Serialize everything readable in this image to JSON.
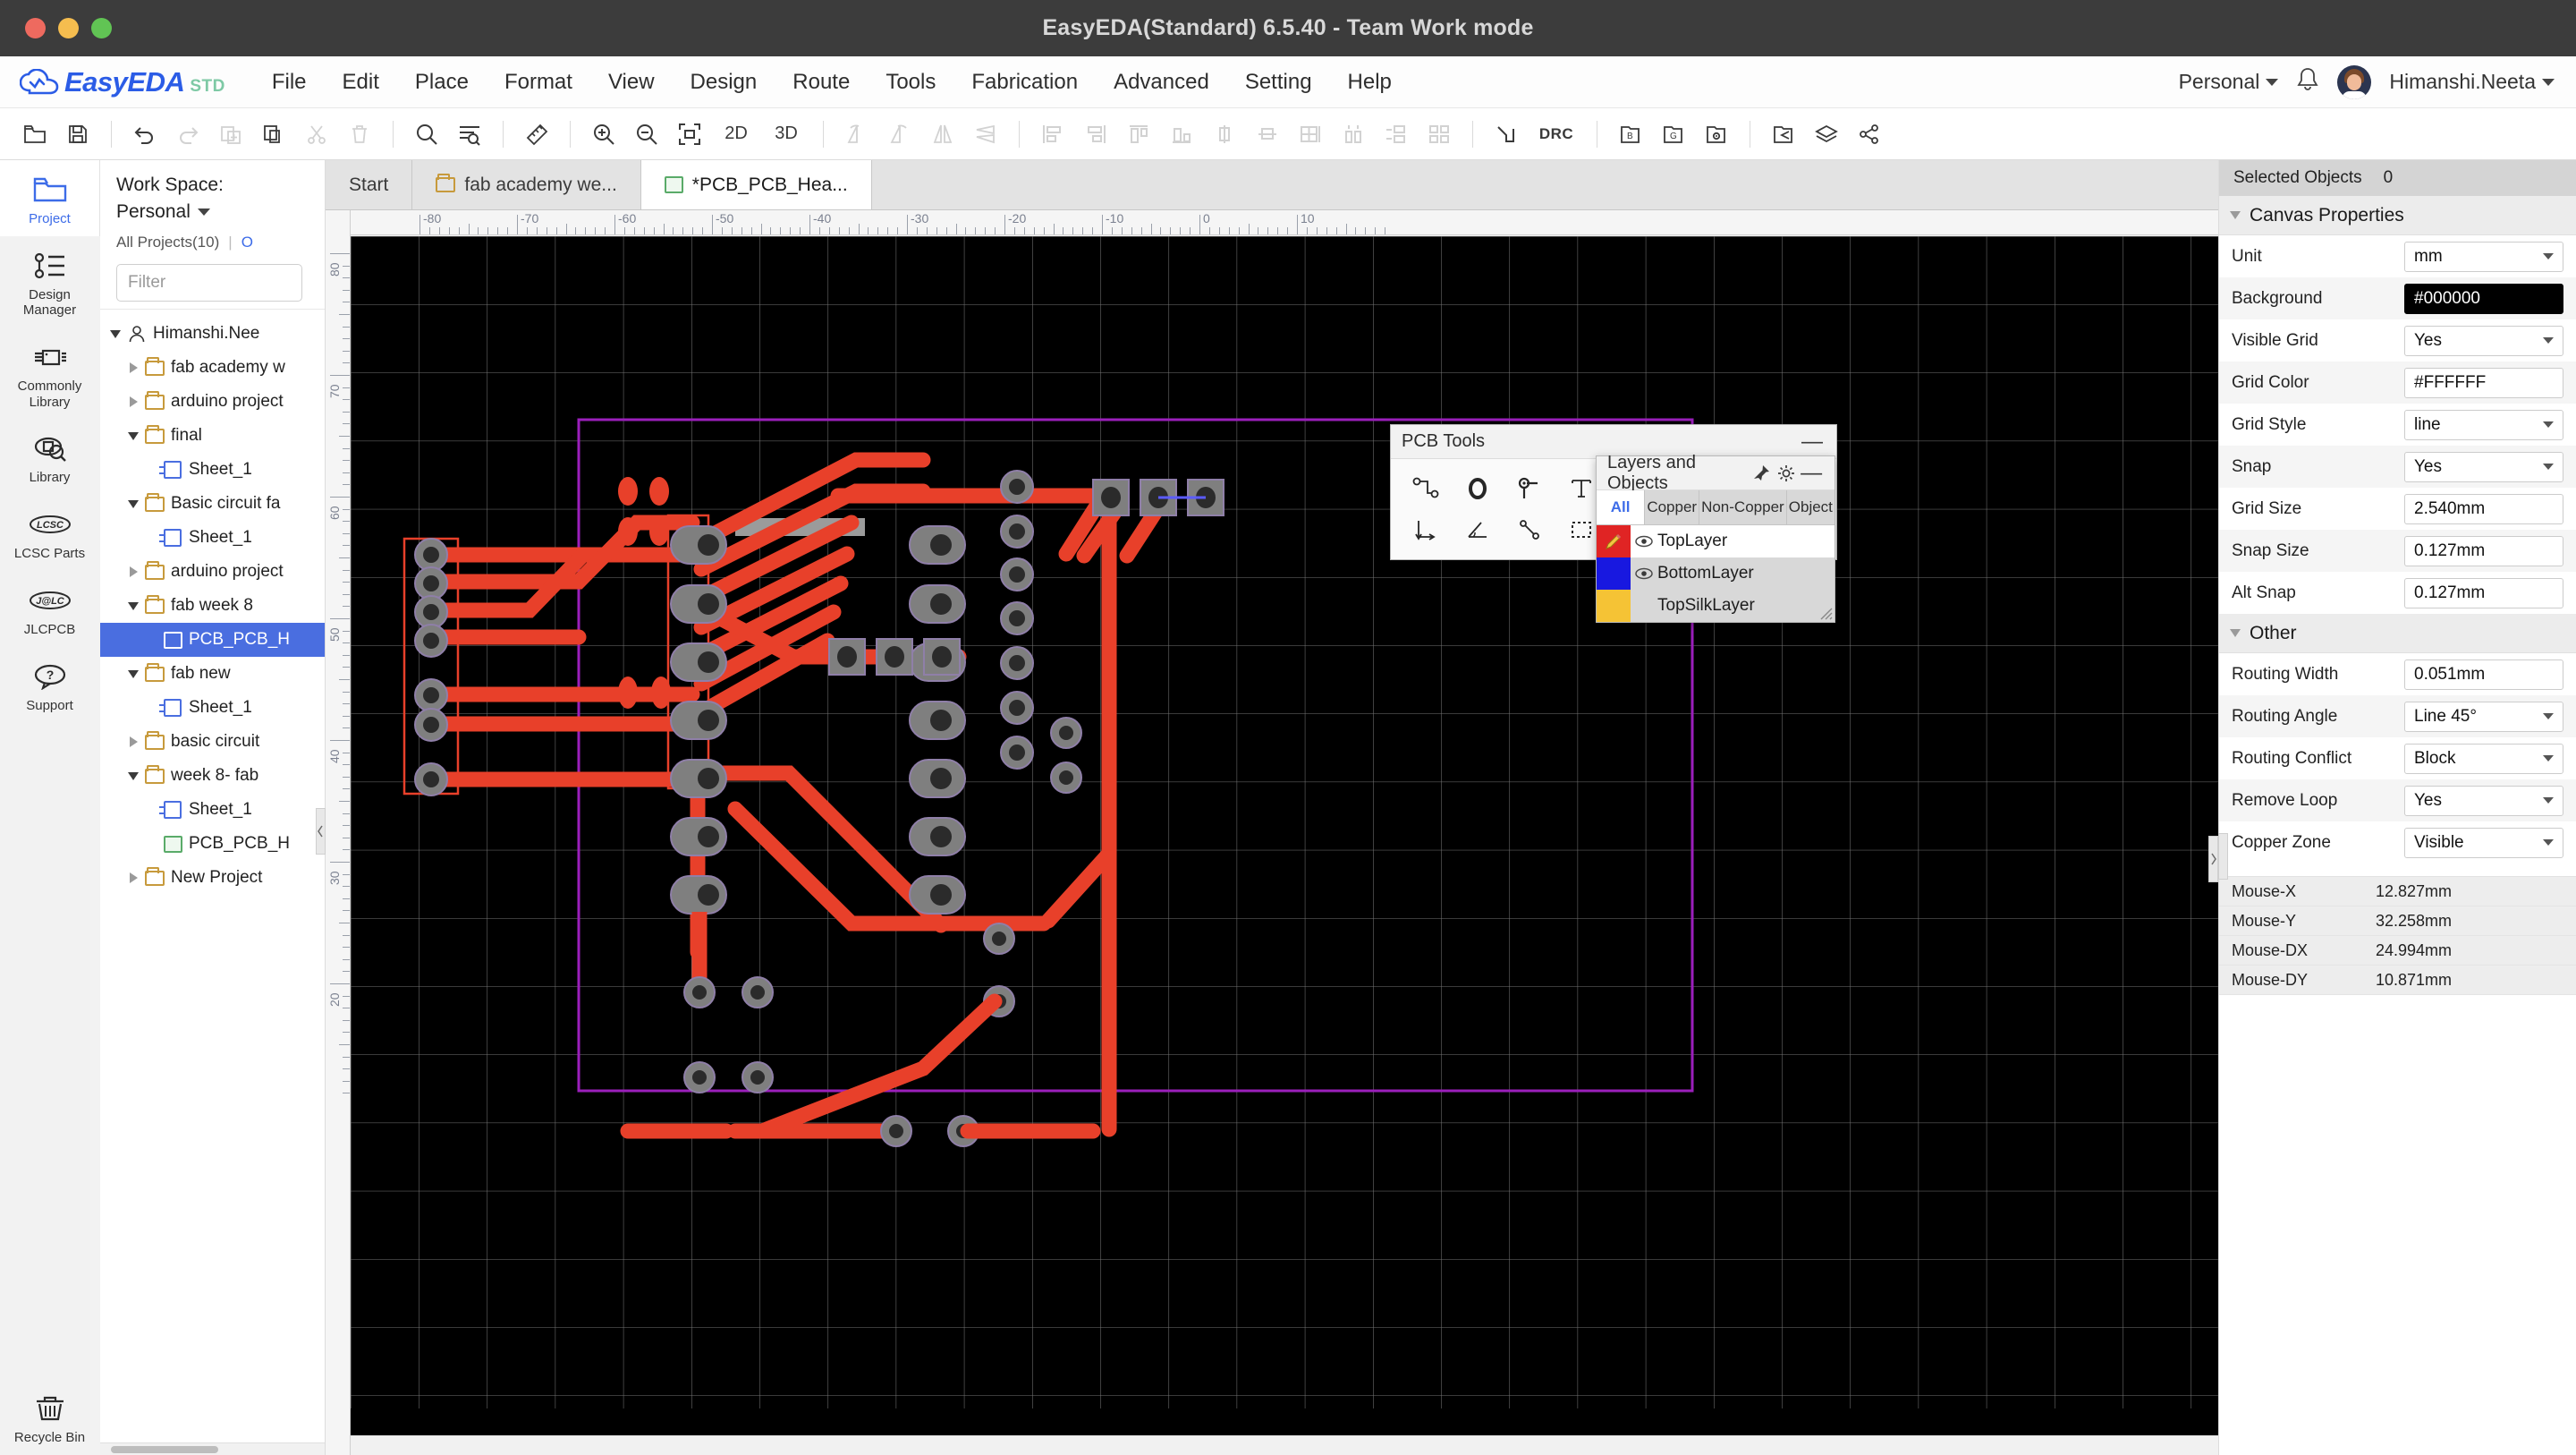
{
  "window": {
    "title": "EasyEDA(Standard) 6.5.40 - Team Work mode"
  },
  "brand": {
    "name": "EasyEDA",
    "suffix": "STD"
  },
  "menu": {
    "items": [
      "File",
      "Edit",
      "Place",
      "Format",
      "View",
      "Design",
      "Route",
      "Tools",
      "Fabrication",
      "Advanced",
      "Setting",
      "Help"
    ],
    "workspace_label": "Personal",
    "account_name": "Himanshi.Neeta"
  },
  "toolbar": {
    "items": [
      {
        "name": "open-folder-icon",
        "label": "",
        "disabled": false
      },
      {
        "name": "save-icon",
        "label": "",
        "disabled": false
      },
      {
        "name": "undo-icon",
        "label": "",
        "disabled": false
      },
      {
        "name": "redo-icon",
        "label": "",
        "disabled": true
      },
      {
        "name": "paste-icon",
        "label": "",
        "disabled": true
      },
      {
        "name": "copy-icon",
        "label": "",
        "disabled": false
      },
      {
        "name": "cut-icon",
        "label": "",
        "disabled": true
      },
      {
        "name": "delete-icon",
        "label": "",
        "disabled": true
      },
      {
        "name": "search-icon",
        "label": "",
        "disabled": false
      },
      {
        "name": "find-similar-icon",
        "label": "",
        "disabled": false
      },
      {
        "name": "ruler-icon",
        "label": "",
        "disabled": false
      },
      {
        "name": "zoom-in-icon",
        "label": "",
        "disabled": false
      },
      {
        "name": "zoom-out-icon",
        "label": "",
        "disabled": false
      },
      {
        "name": "fit-to-screen-icon",
        "label": "",
        "disabled": false
      },
      {
        "name": "view-2d-button",
        "label": "2D",
        "disabled": false
      },
      {
        "name": "view-3d-button",
        "label": "3D",
        "disabled": false
      },
      {
        "name": "rotate-ccw-icon",
        "label": "",
        "disabled": true
      },
      {
        "name": "rotate-cw-icon",
        "label": "",
        "disabled": true
      },
      {
        "name": "mirror-vertical-icon",
        "label": "",
        "disabled": true
      },
      {
        "name": "mirror-horizontal-icon",
        "label": "",
        "disabled": true
      },
      {
        "name": "align-left-icon",
        "label": "",
        "disabled": true
      },
      {
        "name": "align-right-icon",
        "label": "",
        "disabled": true
      },
      {
        "name": "align-top-icon",
        "label": "",
        "disabled": true
      },
      {
        "name": "align-bottom-icon",
        "label": "",
        "disabled": true
      },
      {
        "name": "align-center-vertical-icon",
        "label": "",
        "disabled": true
      },
      {
        "name": "align-center-horizontal-icon",
        "label": "",
        "disabled": true
      },
      {
        "name": "grid-align-icon",
        "label": "",
        "disabled": true
      },
      {
        "name": "distribute-vertical-icon",
        "label": "",
        "disabled": true
      },
      {
        "name": "distribute-horizontal-icon",
        "label": "",
        "disabled": true
      },
      {
        "name": "arrange-icon",
        "label": "",
        "disabled": true
      },
      {
        "name": "autoroute-icon",
        "label": "",
        "disabled": false
      },
      {
        "name": "drc-button",
        "label": "DRC",
        "disabled": false
      },
      {
        "name": "board-outline-icon",
        "label": "B",
        "disabled": false
      },
      {
        "name": "gerber-icon",
        "label": "G",
        "disabled": false
      },
      {
        "name": "drill-icon",
        "label": "",
        "disabled": false
      },
      {
        "name": "import-icon",
        "label": "",
        "disabled": false
      },
      {
        "name": "layers-icon",
        "label": "",
        "disabled": false
      },
      {
        "name": "share-icon",
        "label": "",
        "disabled": false
      }
    ]
  },
  "rail": {
    "items": [
      {
        "name": "project",
        "label": "Project",
        "active": true
      },
      {
        "name": "design-manager",
        "label": "Design Manager",
        "active": false
      },
      {
        "name": "commonly-library",
        "label": "Commonly Library",
        "active": false
      },
      {
        "name": "library",
        "label": "Library",
        "active": false
      },
      {
        "name": "lcsc-parts",
        "label": "LCSC Parts",
        "active": false
      },
      {
        "name": "jlcpcb",
        "label": "JLCPCB",
        "active": false
      },
      {
        "name": "support",
        "label": "Support",
        "active": false
      }
    ],
    "bottom": {
      "name": "recycle-bin",
      "label": "Recycle Bin"
    }
  },
  "project_panel": {
    "workspace_title": "Work Space:",
    "workspace_value": "Personal",
    "all_projects": "All Projects(10)",
    "divider": "|",
    "second_link": "O",
    "filter_placeholder": "Filter",
    "tree": [
      {
        "label": "Himanshi.Nee",
        "indent": 0,
        "twisty": "down",
        "icon": "user",
        "selected": false
      },
      {
        "label": "fab academy w",
        "indent": 1,
        "twisty": "right",
        "icon": "folder",
        "selected": false
      },
      {
        "label": "arduino project",
        "indent": 1,
        "twisty": "right",
        "icon": "folder",
        "selected": false
      },
      {
        "label": "final",
        "indent": 1,
        "twisty": "down",
        "icon": "folder",
        "selected": false
      },
      {
        "label": "Sheet_1",
        "indent": 2,
        "twisty": "none",
        "icon": "sheet",
        "selected": false
      },
      {
        "label": "Basic circuit fa",
        "indent": 1,
        "twisty": "down",
        "icon": "folder",
        "selected": false
      },
      {
        "label": "Sheet_1",
        "indent": 2,
        "twisty": "none",
        "icon": "sheet",
        "selected": false
      },
      {
        "label": "arduino project",
        "indent": 1,
        "twisty": "right",
        "icon": "folder",
        "selected": false
      },
      {
        "label": "fab week 8",
        "indent": 1,
        "twisty": "down",
        "icon": "folder",
        "selected": false
      },
      {
        "label": "PCB_PCB_H",
        "indent": 2,
        "twisty": "none",
        "icon": "pcb",
        "selected": true
      },
      {
        "label": "fab new",
        "indent": 1,
        "twisty": "down",
        "icon": "folder",
        "selected": false
      },
      {
        "label": "Sheet_1",
        "indent": 2,
        "twisty": "none",
        "icon": "sheet",
        "selected": false
      },
      {
        "label": "basic circuit",
        "indent": 1,
        "twisty": "right",
        "icon": "folder",
        "selected": false
      },
      {
        "label": "week 8- fab",
        "indent": 1,
        "twisty": "down",
        "icon": "folder",
        "selected": false
      },
      {
        "label": "Sheet_1",
        "indent": 2,
        "twisty": "none",
        "icon": "sheet",
        "selected": false
      },
      {
        "label": "PCB_PCB_H",
        "indent": 2,
        "twisty": "none",
        "icon": "pcb",
        "selected": false
      },
      {
        "label": "New Project",
        "indent": 1,
        "twisty": "right",
        "icon": "folder",
        "selected": false
      }
    ]
  },
  "tabs": [
    {
      "label": "Start",
      "icon": "none",
      "active": false
    },
    {
      "label": "fab academy we...",
      "icon": "folder",
      "active": false
    },
    {
      "label": "*PCB_PCB_Hea...",
      "icon": "pcb",
      "active": true
    }
  ],
  "rulers": {
    "horizontal_labels": [
      "-80",
      "-70",
      "-60",
      "-50",
      "-40",
      "-30",
      "-20",
      "-10",
      "0",
      "10"
    ],
    "vertical_labels": [
      "80",
      "70",
      "60",
      "50",
      "40",
      "30",
      "20"
    ]
  },
  "pcb_tools": {
    "title": "PCB Tools",
    "minimize": "—",
    "tools": [
      "track-icon",
      "via-icon",
      "pad-icon",
      "text-icon",
      "arc-icon",
      "arc-reverse-icon",
      "circle-icon",
      "rect-icon",
      "dimension-icon",
      "angle-icon",
      "polyline-icon",
      "solid-region-icon",
      "copper-area-icon",
      "measure-icon",
      "image-icon",
      "hole-icon"
    ]
  },
  "layers_panel": {
    "title": "Layers and Objects",
    "pin_icon": "pin-icon",
    "settings_icon": "gear-icon",
    "minimize_icon": "minimize-icon",
    "tabs": [
      "All",
      "Copper",
      "Non-Copper",
      "Object"
    ],
    "active_tab": "All",
    "layers": [
      {
        "name": "TopLayer",
        "color": "#e02424",
        "visible": true,
        "active": true,
        "editing": true
      },
      {
        "name": "BottomLayer",
        "color": "#1818e0",
        "visible": true,
        "active": false,
        "editing": false
      },
      {
        "name": "TopSilkLayer",
        "color": "#f5c335",
        "visible": false,
        "active": false,
        "editing": false
      }
    ]
  },
  "properties": {
    "selected_objects_label": "Selected Objects",
    "selected_objects_count": "0",
    "canvas_section": "Canvas Properties",
    "other_section": "Other",
    "rows": [
      {
        "label": "Unit",
        "value": "mm",
        "type": "select"
      },
      {
        "label": "Background",
        "value": "#000000",
        "type": "color-black"
      },
      {
        "label": "Visible Grid",
        "value": "Yes",
        "type": "select"
      },
      {
        "label": "Grid Color",
        "value": "#FFFFFF",
        "type": "text"
      },
      {
        "label": "Grid Style",
        "value": "line",
        "type": "select"
      },
      {
        "label": "Snap",
        "value": "Yes",
        "type": "select"
      },
      {
        "label": "Grid Size",
        "value": "2.540mm",
        "type": "text"
      },
      {
        "label": "Snap Size",
        "value": "0.127mm",
        "type": "text"
      },
      {
        "label": "Alt Snap",
        "value": "0.127mm",
        "type": "text"
      }
    ],
    "other_rows": [
      {
        "label": "Routing Width",
        "value": "0.051mm",
        "type": "text"
      },
      {
        "label": "Routing Angle",
        "value": "Line 45°",
        "type": "select"
      },
      {
        "label": "Routing Conflict",
        "value": "Block",
        "type": "select"
      },
      {
        "label": "Remove Loop",
        "value": "Yes",
        "type": "select"
      },
      {
        "label": "Copper Zone",
        "value": "Visible",
        "type": "select"
      }
    ],
    "mouse": [
      {
        "key": "Mouse-X",
        "value": "12.827mm"
      },
      {
        "key": "Mouse-Y",
        "value": "32.258mm"
      },
      {
        "key": "Mouse-DX",
        "value": "24.994mm"
      },
      {
        "key": "Mouse-DY",
        "value": "10.871mm"
      }
    ]
  },
  "colors": {
    "accent": "#3d6ce8",
    "top_layer": "#e02424",
    "bottom_layer": "#1818e0",
    "silk_layer": "#f5c335",
    "board_outline": "#9b1fbb",
    "canvas_background": "#000000",
    "grid": "#FFFFFF"
  }
}
